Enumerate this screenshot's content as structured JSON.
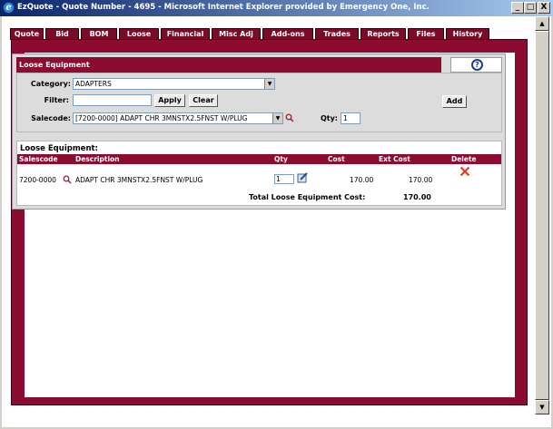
{
  "window": {
    "title": "EzQuote - Quote Number - 4695 - Microsoft Internet Explorer provided by Emergency One, Inc.",
    "icon": "ie-icon",
    "minimize": "_",
    "maximize": "□",
    "close": "X"
  },
  "tabs": [
    {
      "label": "Quote"
    },
    {
      "label": "Bid"
    },
    {
      "label": "BOM"
    },
    {
      "label": "Loose"
    },
    {
      "label": "Financial"
    },
    {
      "label": "Misc Adj"
    },
    {
      "label": "Add-ons"
    },
    {
      "label": "Trades"
    },
    {
      "label": "Reports"
    },
    {
      "label": "Files"
    },
    {
      "label": "History"
    }
  ],
  "section": {
    "title": "Loose Equipment",
    "help_icon": "?"
  },
  "filters": {
    "category_label": "Category:",
    "category_value": "ADAPTERS",
    "filter_label": "Filter:",
    "filter_value": "",
    "apply_label": "Apply",
    "clear_label": "Clear",
    "add_label": "Add",
    "salecode_label": "Salecode:",
    "salecode_value": "[7200-0000] ADAPT CHR 3MNSTX2.5FNST W/PLUG",
    "qty_label": "Qty:",
    "qty_value": "1"
  },
  "results": {
    "title": "Loose Equipment:",
    "columns": {
      "salescode": "Salescode",
      "description": "Description",
      "qty": "Qty",
      "cost": "Cost",
      "ext_cost": "Ext Cost",
      "delete": "Delete"
    },
    "rows": [
      {
        "salescode": "7200-0000",
        "description": "ADAPT CHR 3MNSTX2.5FNST W/PLUG",
        "qty": "1",
        "cost": "170.00",
        "ext_cost": "170.00"
      }
    ],
    "total_label": "Total Loose Equipment Cost:",
    "total_value": "170.00"
  },
  "colors": {
    "accent": "#8c0c31",
    "titlebar": "#0a246a",
    "delete": "#e53b1e"
  }
}
